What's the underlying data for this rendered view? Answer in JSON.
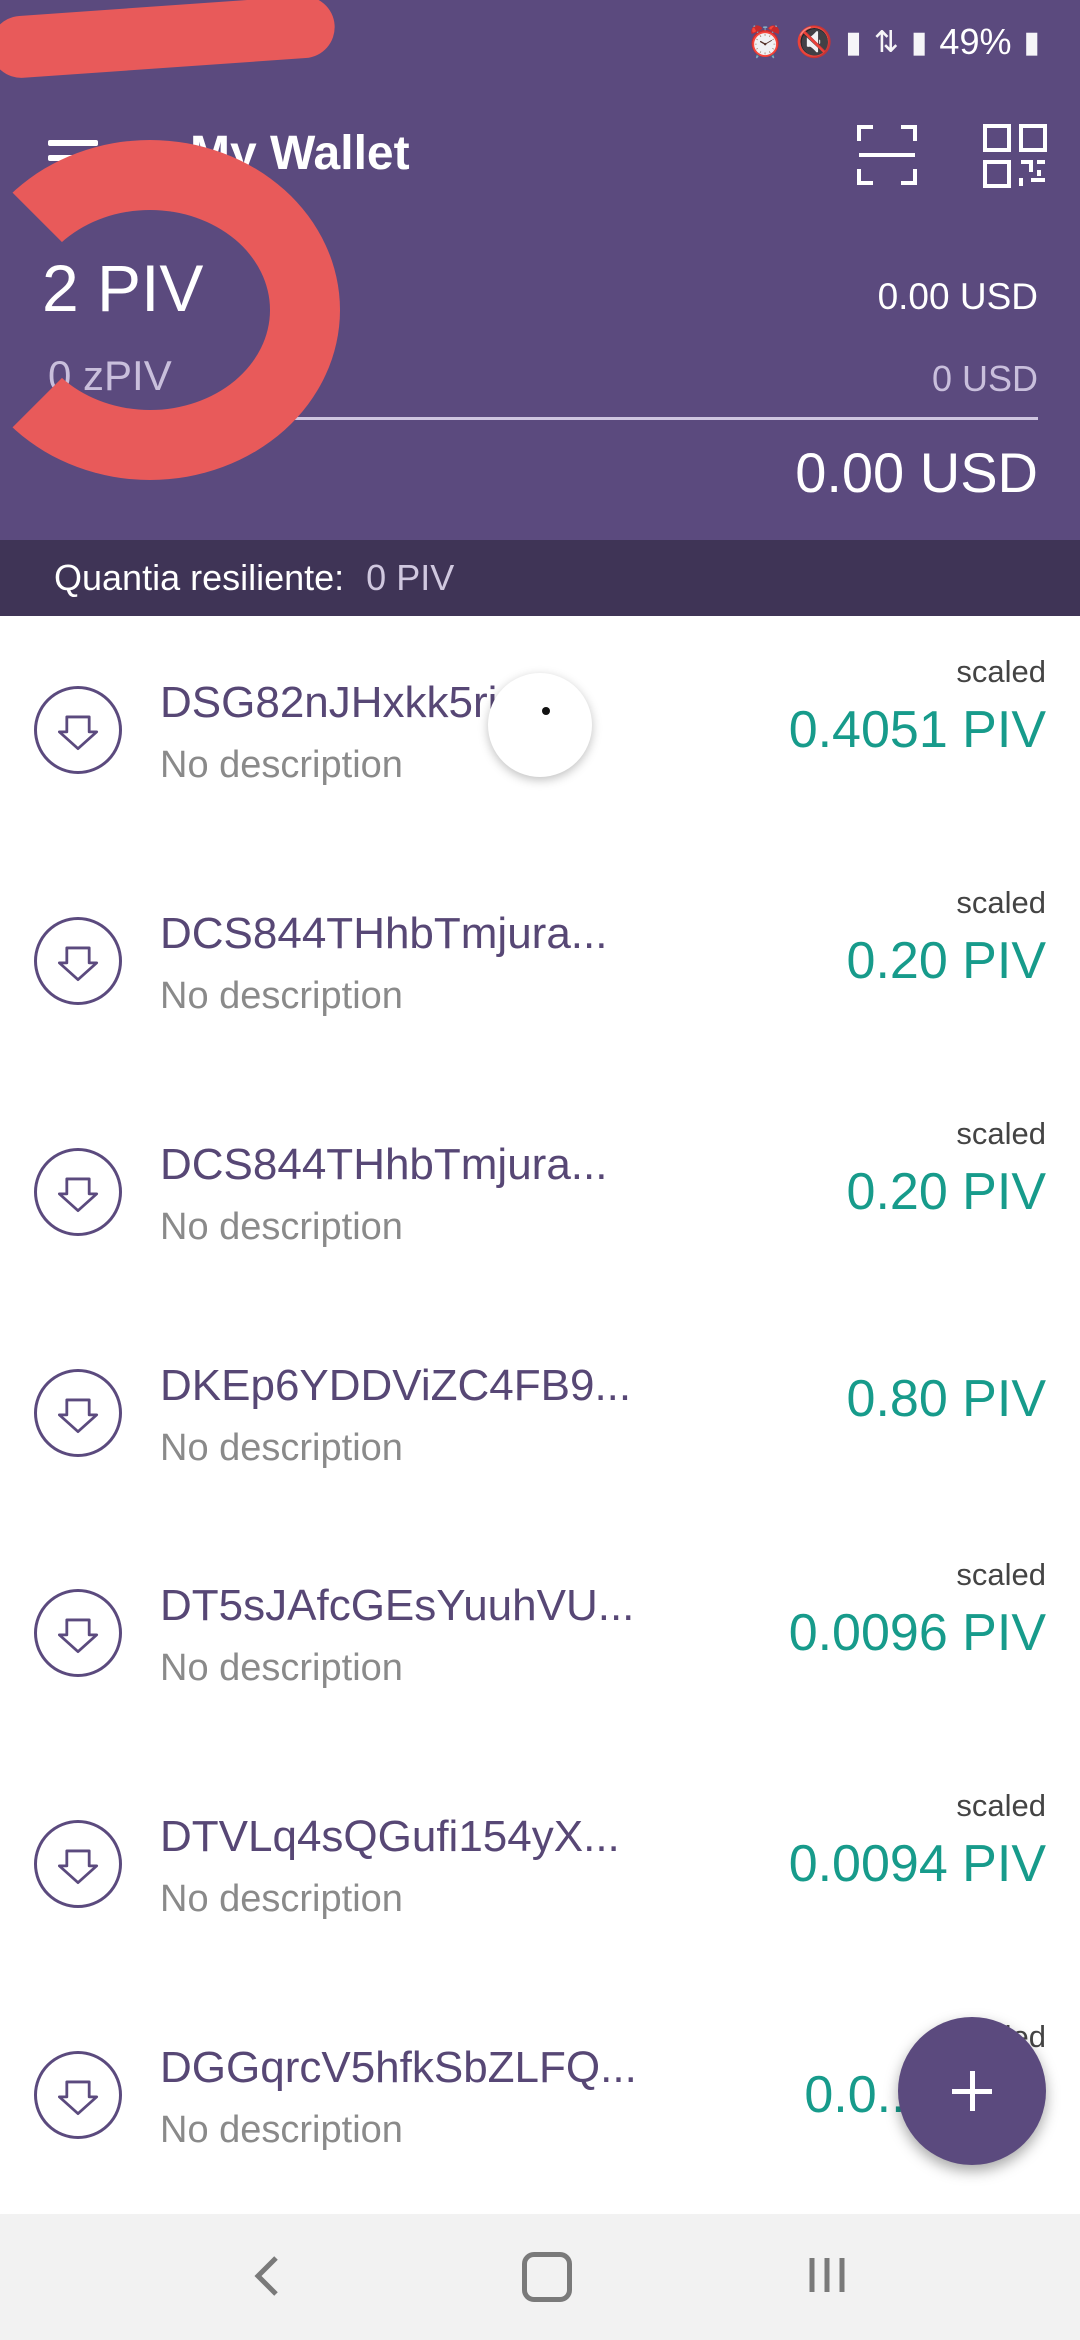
{
  "status_bar": {
    "battery": "49%"
  },
  "header": {
    "title": "My Wallet",
    "balance_piv": "2 PIV",
    "balance_usd": "0.00 USD",
    "zpiv": "0 zPIV",
    "zpiv_usd": "0 USD",
    "total_usd": "0.00 USD"
  },
  "resilient": {
    "label": "Quantia resiliente:",
    "value": "0 PIV"
  },
  "transactions": [
    {
      "address": "DSG82nJHxkk5ri...",
      "description": "No description",
      "amount": "0.4051 PIV",
      "tag": "scaled"
    },
    {
      "address": "DCS844THhbTmjura...",
      "description": "No description",
      "amount": "0.20 PIV",
      "tag": "scaled"
    },
    {
      "address": "DCS844THhbTmjura...",
      "description": "No description",
      "amount": "0.20 PIV",
      "tag": "scaled"
    },
    {
      "address": "DKEp6YDDViZC4FB9...",
      "description": "No description",
      "amount": "0.80 PIV",
      "tag": ""
    },
    {
      "address": "DT5sJAfcGEsYuuhVU...",
      "description": "No description",
      "amount": "0.0096 PIV",
      "tag": "scaled"
    },
    {
      "address": "DTVLq4sQGufi154yX...",
      "description": "No description",
      "amount": "0.0094 PIV",
      "tag": "scaled"
    },
    {
      "address": "DGGqrcV5hfkSbZLFQ...",
      "description": "No description",
      "amount": "0.0...",
      "tag": "scaled"
    }
  ],
  "colors": {
    "primary": "#5b4a7e",
    "accent": "#179b8b",
    "dark_bar": "#3f3456"
  }
}
